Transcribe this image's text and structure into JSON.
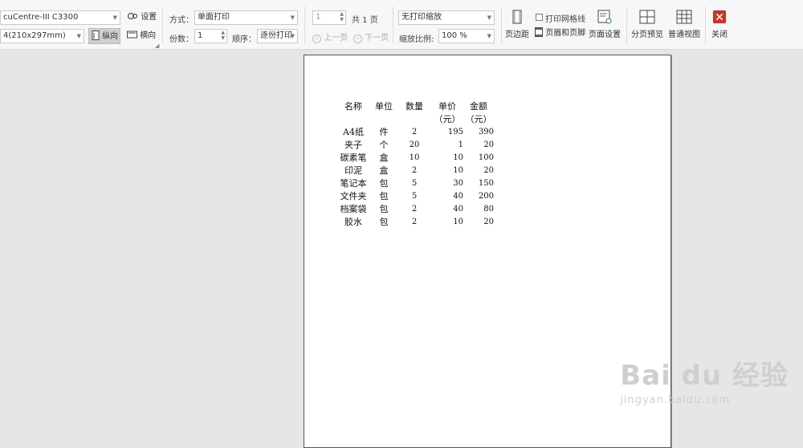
{
  "toolbar": {
    "printer": "cuCentre-III C3300",
    "printer_settings": "设置",
    "paper_size": "4(210x297mm)",
    "portrait": "纵向",
    "landscape": "横向",
    "mode_label": "方式：",
    "mode_value": "单面打印",
    "copies_label": "份数：",
    "copies_value": "1",
    "order_label": "顺序：",
    "order_value": "逐份打印",
    "page_value": "1",
    "total_pages": "共 1 页",
    "prev_page": "上一页",
    "next_page": "下一页",
    "scale_mode": "无打印缩放",
    "scale_label": "缩放比例:",
    "scale_value": "100 %",
    "margins": "页边距",
    "print_gridlines": "打印网格线",
    "header_footer": "页眉和页脚",
    "page_setup": "页面设置",
    "page_break_preview": "分页预览",
    "normal_view": "普通视图",
    "close": "关闭"
  },
  "sheet": {
    "headers": {
      "name": "名称",
      "unit": "单位",
      "qty": "数量",
      "price_line1": "单价",
      "price_line2": "（元）",
      "amount_line1": "金额",
      "amount_line2": "（元）"
    },
    "rows": [
      {
        "name": "A4纸",
        "unit": "件",
        "qty": "2",
        "price": "195",
        "amount": "390"
      },
      {
        "name": "夹子",
        "unit": "个",
        "qty": "20",
        "price": "1",
        "amount": "20"
      },
      {
        "name": "碳素笔",
        "unit": "盒",
        "qty": "10",
        "price": "10",
        "amount": "100"
      },
      {
        "name": "印泥",
        "unit": "盒",
        "qty": "2",
        "price": "10",
        "amount": "20"
      },
      {
        "name": "笔记本",
        "unit": "包",
        "qty": "5",
        "price": "30",
        "amount": "150"
      },
      {
        "name": "文件夹",
        "unit": "包",
        "qty": "5",
        "price": "40",
        "amount": "200"
      },
      {
        "name": "档案袋",
        "unit": "包",
        "qty": "2",
        "price": "40",
        "amount": "80"
      },
      {
        "name": "胶水",
        "unit": "包",
        "qty": "2",
        "price": "10",
        "amount": "20"
      }
    ]
  },
  "watermark": {
    "brand": "Bai du 经验",
    "url": "jingyan.baidu.com"
  },
  "colors": {
    "close_button": "#c0392b",
    "toolbar_bg": "#f7f7f7",
    "workspace_bg": "#e6e6e6"
  }
}
